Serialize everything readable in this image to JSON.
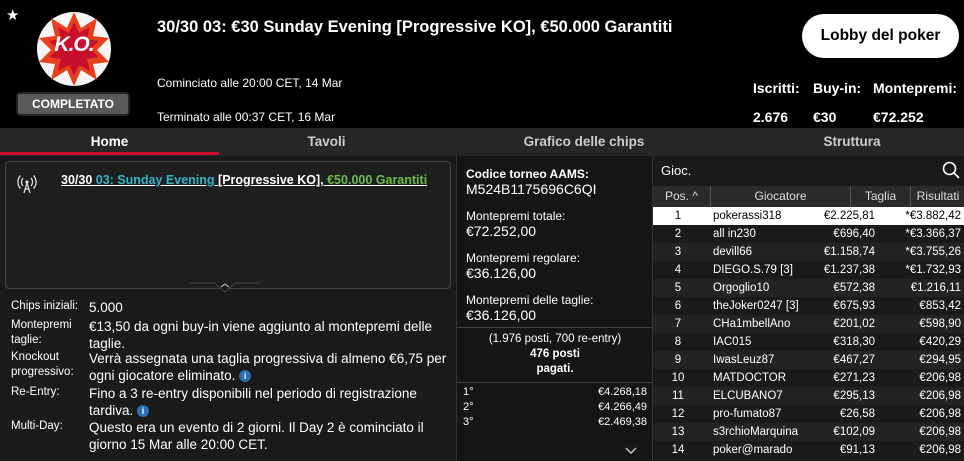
{
  "header": {
    "title": "30/30 03: €30 Sunday Evening [Progressive KO], €50.000 Garantiti",
    "ko_logo_text": "K.O.",
    "status_badge": "COMPLETATO",
    "started": "Cominciato alle 20:00 CET, 14 Mar",
    "ended": "Terminato alle 00:37 CET, 16 Mar",
    "lobby_button": "Lobby del poker",
    "stats": {
      "entrants_label": "Iscritti:",
      "entrants_value": "2.676",
      "buyin_label": "Buy-in:",
      "buyin_value": "€30",
      "prizepool_label": "Montepremi:",
      "prizepool_value": "€72.252"
    }
  },
  "tabs": [
    "Home",
    "Tavoli",
    "Grafico delle chips",
    "Struttura"
  ],
  "home": {
    "title_parts": [
      "30/30 ",
      "03: Sunday Evening ",
      "[Progressive KO]",
      ", ",
      "€50.000 Garantiti"
    ],
    "details": [
      {
        "label": "Chips iniziali:",
        "value": "5.000"
      },
      {
        "label": "Montepremi taglie:",
        "value": "€13,50 da ogni buy-in viene aggiunto al montepremi delle taglie."
      },
      {
        "label": "Knockout progressivo:",
        "value": "Verrà assegnata una taglia progressiva di almeno €6,75 per ogni giocatore eliminato."
      },
      {
        "label": "Re-Entry:",
        "value": "Fino a 3 re-entry disponibili nel periodo di registrazione tardiva."
      },
      {
        "label": "Multi-Day:",
        "value": "Questo era un evento di 2 giorni. Il Day 2 è cominciato il giorno 15 Mar alle 20:00 CET."
      }
    ],
    "info_icon": "i"
  },
  "prizes": {
    "aams_label": "Codice torneo AAMS:",
    "aams_code": "M524B1175696C6QI",
    "total_label": "Montepremi totale:",
    "total_value": "€72.252,00",
    "regular_label": "Montepremi regolare:",
    "regular_value": "€36.126,00",
    "bounty_label": "Montepremi delle taglie:",
    "bounty_value": "€36.126,00",
    "places_line1": "(1.976 posti, 700 re-entry)",
    "places_line2": "476 posti",
    "places_line3": "pagati.",
    "payouts": [
      {
        "pos": "1°",
        "amount": "€4.268,18"
      },
      {
        "pos": "2°",
        "amount": "€4.266,49"
      },
      {
        "pos": "3°",
        "amount": "€2.469,38"
      }
    ]
  },
  "players": {
    "search_label": "Gioc.",
    "columns": [
      "Pos.",
      "Giocatore",
      "Taglia",
      "Risultati"
    ],
    "rows": [
      {
        "pos": "1",
        "name": "pokerassi318",
        "bounty": "€2.225,81",
        "result": "*€3.882,42"
      },
      {
        "pos": "2",
        "name": "all in230",
        "bounty": "€696,40",
        "result": "*€3.366,37"
      },
      {
        "pos": "3",
        "name": "devill66",
        "bounty": "€1.158,74",
        "result": "*€3.755,26"
      },
      {
        "pos": "4",
        "name": "DIEGO.S.79 [3]",
        "bounty": "€1.237,38",
        "result": "*€1.732,93"
      },
      {
        "pos": "5",
        "name": "Orgoglio10",
        "bounty": "€572,38",
        "result": "€1.216,11"
      },
      {
        "pos": "6",
        "name": "theJoker0247 [3]",
        "bounty": "€675,93",
        "result": "€853,42"
      },
      {
        "pos": "7",
        "name": "CHa1mbellAno",
        "bounty": "€201,02",
        "result": "€598,90"
      },
      {
        "pos": "8",
        "name": "IAC015",
        "bounty": "€318,30",
        "result": "€420,29"
      },
      {
        "pos": "9",
        "name": "IwasLeuz87",
        "bounty": "€467,27",
        "result": "€294,95"
      },
      {
        "pos": "10",
        "name": "MATDOCTOR",
        "bounty": "€271,23",
        "result": "€206,98"
      },
      {
        "pos": "11",
        "name": "ELCUBANO7",
        "bounty": "€295,13",
        "result": "€206,98"
      },
      {
        "pos": "12",
        "name": "pro-fumato87",
        "bounty": "€26,58",
        "result": "€206,98"
      },
      {
        "pos": "13",
        "name": "s3rchioMarquina",
        "bounty": "€102,09",
        "result": "€206,98"
      },
      {
        "pos": "14",
        "name": "poker@marado",
        "bounty": "€91,13",
        "result": "€206,98"
      }
    ]
  },
  "colors": {
    "accent": "#c8102e",
    "link_teal": "#34b3c7",
    "link_green": "#6abf4b",
    "info_blue": "#2a6fb0"
  }
}
